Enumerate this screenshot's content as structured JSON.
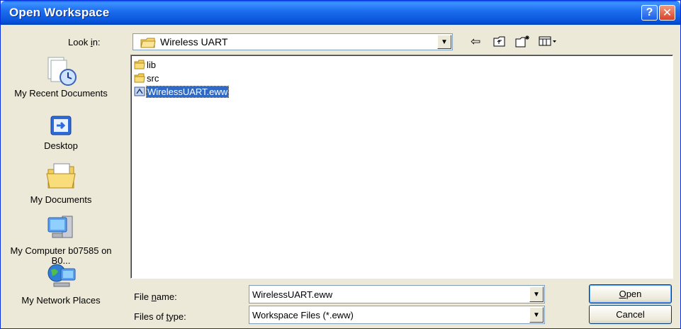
{
  "window": {
    "title": "Open Workspace",
    "help_label": "?",
    "close_label": "✕"
  },
  "lookin": {
    "label_pre": "Look ",
    "label_key": "i",
    "label_post": "n:",
    "value": "Wireless UART"
  },
  "places": [
    {
      "label": "My Recent Documents",
      "icon": "recent-documents-icon"
    },
    {
      "label": "Desktop",
      "icon": "desktop-icon"
    },
    {
      "label": "My Documents",
      "icon": "my-documents-icon"
    },
    {
      "label": "My Computer b07585 on B0...",
      "icon": "my-computer-icon"
    },
    {
      "label": "My Network Places",
      "icon": "network-places-icon"
    }
  ],
  "files": [
    {
      "name": "lib",
      "type": "folder"
    },
    {
      "name": "src",
      "type": "folder"
    },
    {
      "name": "WirelessUART.eww",
      "type": "workspace",
      "selected": true
    }
  ],
  "filename": {
    "label_pre": "File ",
    "label_key": "n",
    "label_post": "ame:",
    "value": "WirelessUART.eww"
  },
  "filetype": {
    "label_pre": "Files of ",
    "label_key": "t",
    "label_post": "ype:",
    "value": "Workspace Files (*.eww)"
  },
  "buttons": {
    "open_key": "O",
    "open_rest": "pen",
    "cancel": "Cancel"
  },
  "colors": {
    "titlebar": "#0752d9",
    "selection": "#316ac5",
    "dialog_bg": "#ece9d8"
  }
}
